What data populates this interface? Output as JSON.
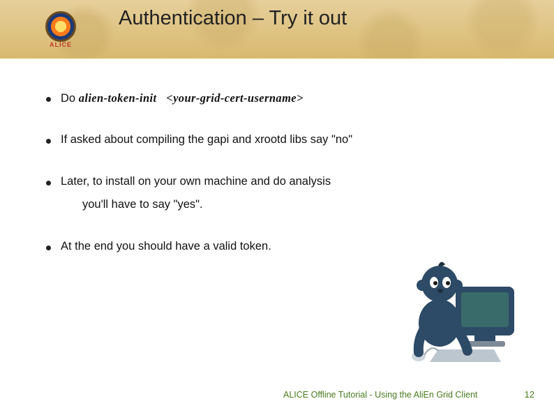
{
  "logo": {
    "text": "ALICE"
  },
  "title": "Authentication – Try it out",
  "bullets": [
    {
      "prefix": "Do ",
      "cmd": "alien-token-init",
      "arg": "<your-grid-cert-username>"
    },
    {
      "text": "If asked about compiling the gapi and xrootd libs say \"no\""
    },
    {
      "text": "Later, to install on your own machine and do analysis",
      "cont": "you'll have to say \"yes\"."
    },
    {
      "text": "At the end you should have a valid token."
    }
  ],
  "footer": "ALICE Offline Tutorial - Using the AliEn Grid Client",
  "page": "12"
}
